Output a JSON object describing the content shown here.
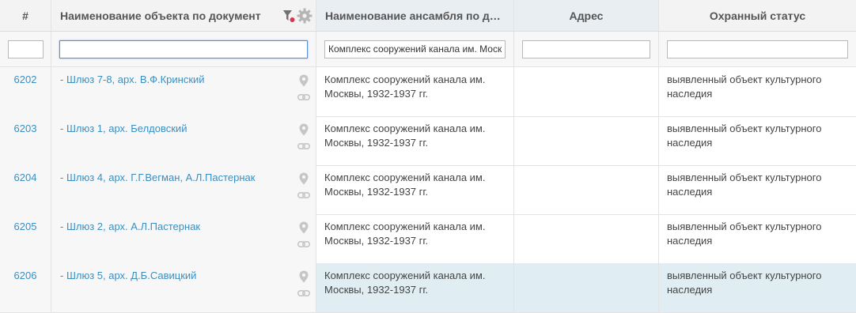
{
  "header": {
    "num": "#",
    "doc_name": "Наименование объекта по документ",
    "ensemble_name": "Наименование ансамбля по документам",
    "address": "Адрес",
    "status": "Охранный статус"
  },
  "filters": {
    "num": "",
    "doc_name": "",
    "ensemble": "Комплекс сооружений канала им. Москвы",
    "address": "",
    "status": ""
  },
  "rows": [
    {
      "id": "6202",
      "name": "- Шлюз 7-8, арх. В.Ф.Кринский",
      "ensemble": "Комплекс сооружений канала им. Москвы, 1932-1937 гг.",
      "address": "",
      "status": "выявленный объект культурного наследия"
    },
    {
      "id": "6203",
      "name": "- Шлюз 1, арх. Белдовский",
      "ensemble": "Комплекс сооружений канала им. Москвы, 1932-1937 гг.",
      "address": "",
      "status": "выявленный объект культурного наследия"
    },
    {
      "id": "6204",
      "name": "- Шлюз 4, арх. Г.Г.Вегман, А.Л.Пастернак",
      "ensemble": "Комплекс сооружений канала им. Москвы, 1932-1937 гг.",
      "address": "",
      "status": "выявленный объект культурного наследия"
    },
    {
      "id": "6205",
      "name": "- Шлюз 2, арх. А.Л.Пастернак",
      "ensemble": "Комплекс сооружений канала им. Москвы, 1932-1937 гг.",
      "address": "",
      "status": "выявленный объект культурного наследия"
    },
    {
      "id": "6206",
      "name": "- Шлюз 5, арх. Д.Б.Савицкий",
      "ensemble": "Комплекс сооружений канала им. Москвы, 1932-1937 гг.",
      "address": "",
      "status": "выявленный объект культурного наследия"
    }
  ],
  "icons": {
    "filter": "filter-icon",
    "settings": "gear-icon",
    "map_marker": "map-marker-icon",
    "link": "link-icon"
  },
  "colors": {
    "link": "#3a8fc2",
    "header_bg": "#f3f3f3",
    "selected_row_bg": "#e0eef4",
    "filter_active_dot": "#e0334d"
  },
  "selected_row": "6206"
}
